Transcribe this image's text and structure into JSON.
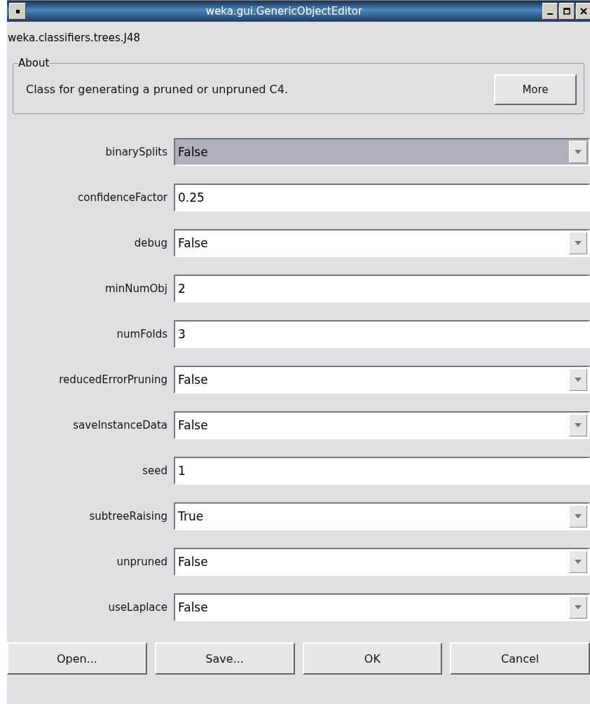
{
  "window": {
    "title": "weka.gui.GenericObjectEditor"
  },
  "class_name": "weka.classifiers.trees.J48",
  "about": {
    "legend": "About",
    "text": "Class for generating a pruned or unpruned C4.",
    "button": "More"
  },
  "properties": [
    {
      "label": "binarySplits",
      "kind": "dropdown",
      "value": "False",
      "focused": true
    },
    {
      "label": "confidenceFactor",
      "kind": "text",
      "value": "0.25"
    },
    {
      "label": "debug",
      "kind": "dropdown",
      "value": "False",
      "focused": false
    },
    {
      "label": "minNumObj",
      "kind": "text",
      "value": "2"
    },
    {
      "label": "numFolds",
      "kind": "text",
      "value": "3"
    },
    {
      "label": "reducedErrorPruning",
      "kind": "dropdown",
      "value": "False",
      "focused": false
    },
    {
      "label": "saveInstanceData",
      "kind": "dropdown",
      "value": "False",
      "focused": false
    },
    {
      "label": "seed",
      "kind": "text",
      "value": "1"
    },
    {
      "label": "subtreeRaising",
      "kind": "dropdown",
      "value": "True",
      "focused": false
    },
    {
      "label": "unpruned",
      "kind": "dropdown",
      "value": "False",
      "focused": false
    },
    {
      "label": "useLaplace",
      "kind": "dropdown",
      "value": "False",
      "focused": false
    }
  ],
  "buttons": [
    "Open...",
    "Save...",
    "OK",
    "Cancel"
  ]
}
